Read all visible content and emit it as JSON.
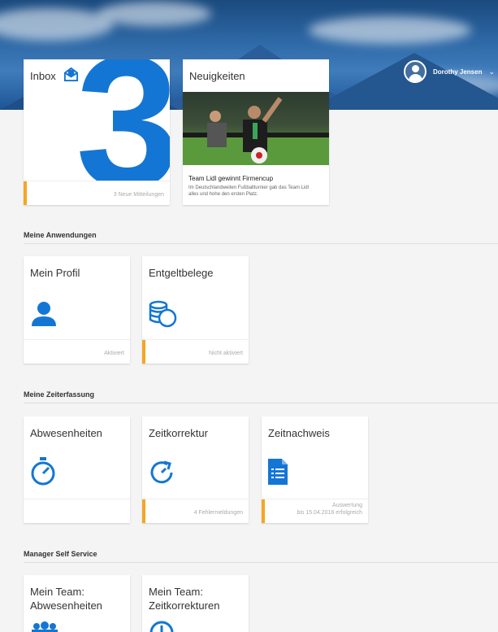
{
  "header": {
    "user_name": "Dorothy Jensen",
    "chevron": "⌄"
  },
  "inbox": {
    "title": "Inbox",
    "count": "3",
    "footer": "3 Neue Mitteilungen",
    "icon": "envelope-icon"
  },
  "news": {
    "title": "Neuigkeiten",
    "headline": "Team Lidl gewinnt Firmencup",
    "text": "Im Deutschlandweiten Fußballturnier gab das Team Lidl alles und hohe den ersten Platz."
  },
  "sections": [
    {
      "title": "Meine Anwendungen",
      "tiles": [
        {
          "title": "Mein Profil",
          "footer": "Aktiviert",
          "icon": "person-icon",
          "accent": false
        },
        {
          "title": "Entgeltbelege",
          "footer": "Nicht aktiviert",
          "icon": "coins-icon",
          "accent": true
        }
      ]
    },
    {
      "title": "Meine Zeiterfassung",
      "tiles": [
        {
          "title": "Abwesenheiten",
          "footer": "",
          "icon": "stopwatch-icon",
          "accent": false
        },
        {
          "title": "Zeitkorrektur",
          "footer": "4 Fehlermeldungen",
          "icon": "clock-refresh-icon",
          "accent": true
        },
        {
          "title": "Zeitnachweis",
          "footer_line1": "Auswertung",
          "footer_line2": "bis 15.04.2016 erfolgreich",
          "icon": "document-icon",
          "accent": true
        }
      ]
    },
    {
      "title": "Manager Self Service",
      "tiles": [
        {
          "title_line1": "Mein Team:",
          "title_line2": "Abwesenheiten",
          "icon": "team-icon"
        },
        {
          "title_line1": "Mein Team:",
          "title_line2": "Zeitkorrekturen",
          "icon": "clock-icon"
        }
      ]
    }
  ],
  "colors": {
    "brand_blue": "#1476d4",
    "accent_orange": "#f5a623",
    "background": "#f4f4f4"
  }
}
